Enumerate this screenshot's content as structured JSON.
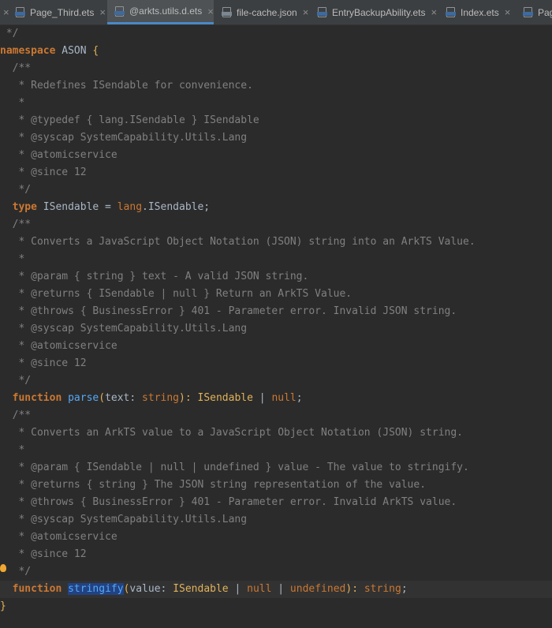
{
  "tabs": [
    {
      "label": "Page_Third.ets",
      "close": "×",
      "active": false
    },
    {
      "label": "@arkts.utils.d.ets",
      "close": "×",
      "active": true
    },
    {
      "label": "file-cache.json",
      "close": "×",
      "active": false
    },
    {
      "label": "EntryBackupAbility.ets",
      "close": "×",
      "active": false
    },
    {
      "label": "Index.ets",
      "close": "×",
      "active": false
    },
    {
      "label": "Pag",
      "close": "",
      "active": false
    }
  ],
  "first_close": "×",
  "code": {
    "l0": " */",
    "ns_kw": "namespace",
    "ns_name": " ASON ",
    "ns_open": "{",
    "c1": [
      "  /**",
      "   * Redefines ISendable for convenience.",
      "   *",
      "   * @typedef { lang.ISendable } ISendable",
      "   * @syscap SystemCapability.Utils.Lang",
      "   * @atomicservice",
      "   * @since 12",
      "   */"
    ],
    "type_kw": "  type",
    "type_name": " ISendable = ",
    "type_ns": "lang",
    "type_rest": ".ISendable;",
    "c2": [
      "  /**",
      "   * Converts a JavaScript Object Notation (JSON) string into an ArkTS Value.",
      "   *",
      "   * @param { string } text - A valid JSON string.",
      "   * @returns { ISendable | null } Return an ArkTS Value.",
      "   * @throws { BusinessError } 401 - Parameter error. Invalid JSON string.",
      "   * @syscap SystemCapability.Utils.Lang",
      "   * @atomicservice",
      "   * @since 12",
      "   */"
    ],
    "parse_kw": "  function",
    "parse_name": "parse",
    "parse_open": "(",
    "parse_param": "text",
    "parse_colon": ": ",
    "parse_ptype": "string",
    "parse_close": "): ",
    "parse_ret1": "ISendable",
    "parse_pipe": " | ",
    "parse_ret2": "null",
    "parse_semi": ";",
    "c3": [
      "  /**",
      "   * Converts an ArkTS value to a JavaScript Object Notation (JSON) string.",
      "   *",
      "   * @param { ISendable | null | undefined } value - The value to stringify.",
      "   * @returns { string } The JSON string representation of the value.",
      "   * @throws { BusinessError } 401 - Parameter error. Invalid ArkTS value.",
      "   * @syscap SystemCapability.Utils.Lang",
      "   * @atomicservice",
      "   * @since 12",
      "   */"
    ],
    "str_kw": "  function",
    "str_name": "stringify",
    "str_open": "(",
    "str_param": "value",
    "str_colon": ": ",
    "str_t1": "ISendable",
    "str_p1": " | ",
    "str_t2": "null",
    "str_p2": " | ",
    "str_t3": "undefined",
    "str_close": "): ",
    "str_ret": "string",
    "str_semi": ";",
    "ns_close": "}"
  },
  "colors": {
    "background": "#2b2b2b",
    "comment": "#808080",
    "keyword": "#cc7832",
    "function": "#56a8f5",
    "type": "#e2b25a",
    "selection": "#214283",
    "accent": "#4a88c7"
  }
}
